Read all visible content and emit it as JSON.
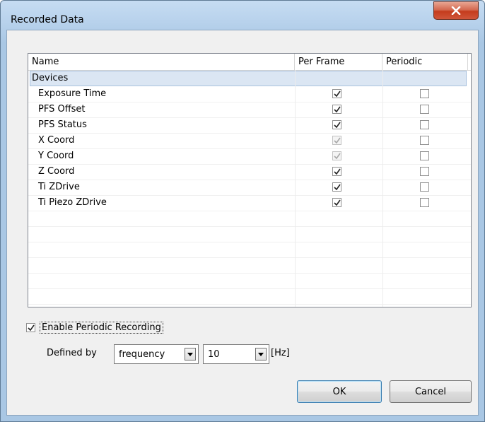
{
  "window": {
    "title": "Recorded Data",
    "close_glyph": "X"
  },
  "table": {
    "columns": [
      "Name",
      "Per Frame",
      "Periodic"
    ],
    "group": "Devices",
    "rows": [
      {
        "name": "Exposure Time",
        "per_frame": true,
        "per_frame_disabled": false,
        "periodic": false
      },
      {
        "name": "PFS Offset",
        "per_frame": true,
        "per_frame_disabled": false,
        "periodic": false
      },
      {
        "name": "PFS Status",
        "per_frame": true,
        "per_frame_disabled": false,
        "periodic": false
      },
      {
        "name": "X Coord",
        "per_frame": true,
        "per_frame_disabled": true,
        "periodic": false
      },
      {
        "name": "Y Coord",
        "per_frame": true,
        "per_frame_disabled": true,
        "periodic": false
      },
      {
        "name": "Z Coord",
        "per_frame": true,
        "per_frame_disabled": false,
        "periodic": false
      },
      {
        "name": "Ti ZDrive",
        "per_frame": true,
        "per_frame_disabled": false,
        "periodic": false
      },
      {
        "name": "Ti Piezo ZDrive",
        "per_frame": true,
        "per_frame_disabled": false,
        "periodic": false
      }
    ]
  },
  "periodic": {
    "enable_label": "Enable Periodic Recording",
    "enabled": true,
    "defined_by_label": "Defined by",
    "mode_value": "frequency",
    "value": "10",
    "unit": "[Hz]"
  },
  "buttons": {
    "ok": "OK",
    "cancel": "Cancel"
  },
  "colors": {
    "title_bar": "#b8d2ec",
    "close_button": "#c43c1d",
    "group_row": "#dbe6f3"
  }
}
